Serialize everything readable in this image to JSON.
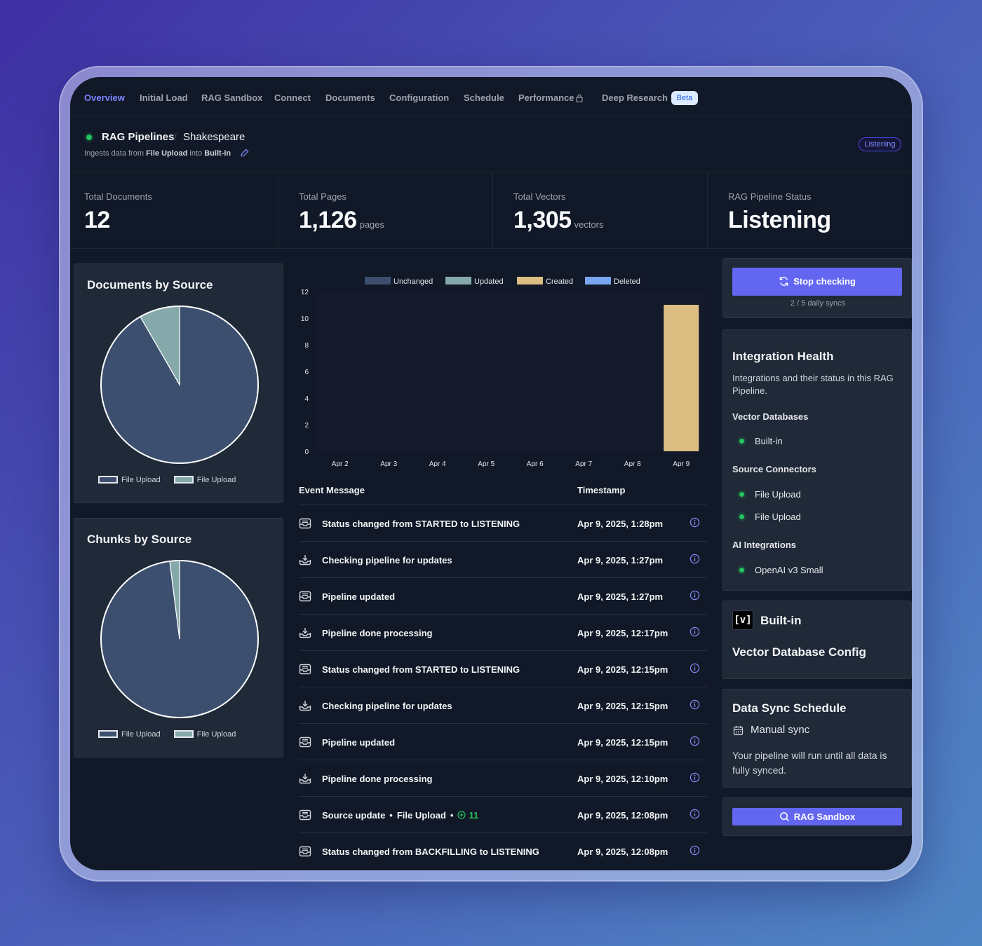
{
  "nav": {
    "tabs": [
      {
        "label": "Overview",
        "active": true
      },
      {
        "label": "Initial Load"
      },
      {
        "label": "RAG Sandbox"
      },
      {
        "label": "Connect"
      },
      {
        "label": "Documents"
      },
      {
        "label": "Configuration"
      },
      {
        "label": "Schedule"
      },
      {
        "label": "Performance",
        "icon": "lock-icon"
      },
      {
        "label": "Deep Research",
        "badge": "Beta"
      }
    ]
  },
  "header": {
    "breadcrumb": [
      "RAG Pipelines",
      "Shakespeare"
    ],
    "separator": "/",
    "subtitle_prefix": "Ingests data from",
    "source": "File Upload",
    "subtitle_mid": "into",
    "destination": "Built-in",
    "status_badge": "Listening"
  },
  "stats": [
    {
      "label": "Total Documents",
      "value": "12",
      "unit": ""
    },
    {
      "label": "Total Pages",
      "value": "1,126",
      "unit": "pages"
    },
    {
      "label": "Total Vectors",
      "value": "1,305",
      "unit": "vectors"
    },
    {
      "label": "RAG Pipeline Status",
      "value": "Listening",
      "unit": ""
    }
  ],
  "documents_by_source": {
    "title": "Documents by Source",
    "legend": [
      "File Upload",
      "File Upload"
    ]
  },
  "chunks_by_source": {
    "title": "Chunks by Source",
    "legend": [
      "File Upload",
      "File Upload"
    ]
  },
  "colors": {
    "unchanged": "#3d4f6e",
    "updated": "#85a9ab",
    "created": "#dcbe82",
    "deleted": "#7aa5f0",
    "accent": "#6366f1",
    "success": "#22c55e"
  },
  "chart_data": [
    {
      "type": "pie",
      "title": "Documents by Source",
      "labels": [
        "File Upload",
        "File Upload"
      ],
      "values": [
        11,
        1
      ]
    },
    {
      "type": "pie",
      "title": "Chunks by Source",
      "labels": [
        "File Upload",
        "File Upload"
      ],
      "values": [
        98,
        2
      ]
    },
    {
      "type": "bar",
      "stacked": true,
      "categories": [
        "Apr 2",
        "Apr 3",
        "Apr 4",
        "Apr 5",
        "Apr 6",
        "Apr 7",
        "Apr 8",
        "Apr 9"
      ],
      "series": [
        {
          "name": "Unchanged",
          "values": [
            0,
            0,
            0,
            0,
            0,
            0,
            0,
            0
          ]
        },
        {
          "name": "Updated",
          "values": [
            0,
            0,
            0,
            0,
            0,
            0,
            0,
            0
          ]
        },
        {
          "name": "Created",
          "values": [
            0,
            0,
            0,
            0,
            0,
            0,
            0,
            11
          ]
        },
        {
          "name": "Deleted",
          "values": [
            0,
            0,
            0,
            0,
            0,
            0,
            0,
            0
          ]
        }
      ],
      "ylim": [
        0,
        12
      ],
      "yticks": [
        0,
        2,
        4,
        6,
        8,
        10,
        12
      ],
      "legend_position": "top"
    }
  ],
  "events": {
    "col_message": "Event Message",
    "col_timestamp": "Timestamp",
    "rows": [
      {
        "icon": "inbox-icon",
        "message": "Status changed from STARTED to LISTENING",
        "timestamp": "Apr 9, 2025, 1:28pm"
      },
      {
        "icon": "download-tray-icon",
        "message": "Checking pipeline for updates",
        "timestamp": "Apr 9, 2025, 1:27pm"
      },
      {
        "icon": "inbox-icon",
        "message": "Pipeline updated",
        "timestamp": "Apr 9, 2025, 1:27pm"
      },
      {
        "icon": "download-tray-icon",
        "message": "Pipeline done processing",
        "timestamp": "Apr 9, 2025, 12:17pm"
      },
      {
        "icon": "inbox-icon",
        "message": "Status changed from STARTED to LISTENING",
        "timestamp": "Apr 9, 2025, 12:15pm"
      },
      {
        "icon": "download-tray-icon",
        "message": "Checking pipeline for updates",
        "timestamp": "Apr 9, 2025, 12:15pm"
      },
      {
        "icon": "inbox-icon",
        "message": "Pipeline updated",
        "timestamp": "Apr 9, 2025, 12:15pm"
      },
      {
        "icon": "download-tray-icon",
        "message": "Pipeline done processing",
        "timestamp": "Apr 9, 2025, 12:10pm"
      },
      {
        "icon": "inbox-icon",
        "message": "Source update",
        "source": "File Upload",
        "added": "11",
        "timestamp": "Apr 9, 2025, 12:08pm"
      },
      {
        "icon": "inbox-icon",
        "message": "Status changed from BACKFILLING to LISTENING",
        "timestamp": "Apr 9, 2025, 12:08pm"
      }
    ]
  },
  "sync_control": {
    "button_label": "Stop checking",
    "daily_syncs": "2 / 5 daily syncs"
  },
  "integration_health": {
    "title": "Integration Health",
    "description": "Integrations and their status in this RAG Pipeline.",
    "vector_db_heading": "Vector Databases",
    "vector_dbs": [
      "Built-in"
    ],
    "source_heading": "Source Connectors",
    "sources": [
      "File Upload",
      "File Upload"
    ],
    "ai_heading": "AI Integrations",
    "ai": [
      "OpenAI v3 Small"
    ]
  },
  "vector_db_config": {
    "logo_text": "[v]",
    "name": "Built-in",
    "title": "Vector Database Config"
  },
  "sync_schedule": {
    "title": "Data Sync Schedule",
    "mode": "Manual sync",
    "description": "Your pipeline will run until all data is fully synced."
  },
  "sandbox_button": {
    "label": "RAG Sandbox"
  }
}
